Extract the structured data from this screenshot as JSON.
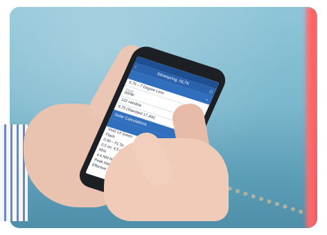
{
  "app": {
    "status_carrier": "",
    "status_time": "",
    "title": "",
    "title_right": "Stinespring, NLTK",
    "back_icon": "chevron-left-icon",
    "share_icon": "share-icon"
  },
  "sections": [
    {
      "heading": "",
      "fields": [
        {
          "label": "",
          "value": "5.75 – 7 Degree Lens"
        },
        {
          "label": "Range",
          "value": "000W"
        },
        {
          "label": "",
          "value": "122 candela"
        },
        {
          "label": "",
          "value": "6.75 (Standard 17.3W)"
        }
      ]
    },
    {
      "heading": "Solar Calculations",
      "fields": []
    },
    {
      "heading": "",
      "lines": [
        "Vivid 1X Green",
        "Flash",
        "0.00 – FL 5s",
        "0.5 on, 4.5 off",
        "85%",
        "4.4 NM Night Time",
        "Peak Intensity: 72",
        "Effective Intensity"
      ]
    }
  ],
  "colors": {
    "app_bar": "#2a62ad",
    "status_bar": "#1f4f93",
    "section_head": "#2f6fbe"
  }
}
